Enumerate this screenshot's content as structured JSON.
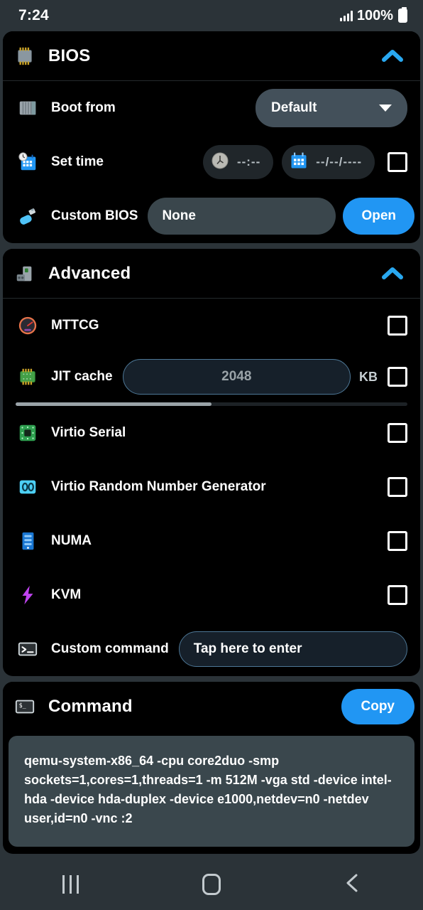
{
  "status_bar": {
    "time": "7:24",
    "battery_percent": "100%",
    "signal_icon": "cellular-signal-icon",
    "battery_icon": "battery-full-icon"
  },
  "colors": {
    "accent_blue": "#2196f3",
    "page_background": "#2b3338",
    "card_background": "#000000",
    "field_grey": "#3a464c",
    "field_navy": "#16202a",
    "command_box": "#3a474d"
  },
  "sections": {
    "bios": {
      "title": "BIOS",
      "icon": "chip-icon",
      "collapse_icon": "chevron-up-icon",
      "rows": {
        "boot_from": {
          "label": "Boot from",
          "icon": "hard-drive-icon",
          "selected": "Default",
          "caret_icon": "caret-down-icon"
        },
        "set_time": {
          "label": "Set time",
          "icon": "calendar-clock-icon",
          "time_placeholder": "--:--",
          "date_placeholder": "--/--/----",
          "time_icon": "clock-icon",
          "date_icon": "calendar-icon",
          "checkbox_checked": false
        },
        "custom_bios": {
          "label": "Custom BIOS",
          "icon": "usb-drive-icon",
          "value": "None",
          "button_label": "Open"
        }
      }
    },
    "advanced": {
      "title": "Advanced",
      "icon": "robot-icon",
      "collapse_icon": "chevron-up-icon",
      "rows": [
        {
          "label": "MTTCG",
          "icon": "gauge-icon",
          "type": "checkbox",
          "checked": false
        },
        {
          "label": "JIT cache",
          "icon": "green-chip-icon",
          "type": "input-checkbox",
          "value": "2048",
          "unit": "KB",
          "checked": false
        },
        {
          "label": "Virtio Serial",
          "icon": "green-processor-icon",
          "type": "checkbox",
          "checked": false
        },
        {
          "label": "Virtio Random Number Generator",
          "icon": "cyan-rng-icon",
          "type": "checkbox",
          "checked": false
        },
        {
          "label": "NUMA",
          "icon": "blue-server-icon",
          "type": "checkbox",
          "checked": false
        },
        {
          "label": "KVM",
          "icon": "purple-lightning-icon",
          "type": "checkbox",
          "checked": false
        },
        {
          "label": "Custom command",
          "icon": "terminal-icon",
          "type": "text-input",
          "placeholder": "Tap here to enter"
        }
      ]
    },
    "command": {
      "title": "Command",
      "icon": "terminal-icon",
      "copy_label": "Copy",
      "text": "qemu-system-x86_64 -cpu core2duo -smp sockets=1,cores=1,threads=1 -m 512M -vga std -device intel-hda -device hda-duplex -device e1000,netdev=n0 -netdev user,id=n0 -vnc :2"
    }
  },
  "nav_bar": {
    "recents_icon": "recents-icon",
    "home_icon": "home-icon",
    "back_icon": "back-icon"
  }
}
